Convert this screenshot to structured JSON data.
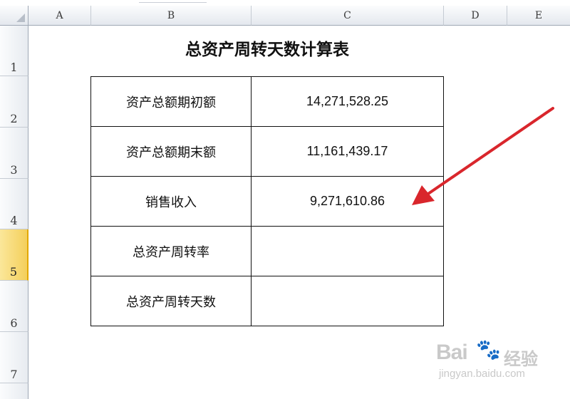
{
  "spreadsheet": {
    "columns": [
      "A",
      "B",
      "C",
      "D",
      "E"
    ],
    "rows": [
      "1",
      "2",
      "3",
      "4",
      "5",
      "6",
      "7"
    ],
    "active_row": "5",
    "title": "总资产周转天数计算表",
    "table": [
      {
        "label": "资产总额期初额",
        "value": "14,271,528.25"
      },
      {
        "label": "资产总额期末额",
        "value": "11,161,439.17"
      },
      {
        "label": "销售收入",
        "value": "9,271,610.86"
      },
      {
        "label": "总资产周转率",
        "value": ""
      },
      {
        "label": "总资产周转天数",
        "value": ""
      }
    ]
  },
  "annotation": {
    "arrow_color": "#d9262c"
  },
  "watermark": {
    "brand": "Bai",
    "brand2": "经验",
    "url": "jingyan.baidu.com"
  }
}
